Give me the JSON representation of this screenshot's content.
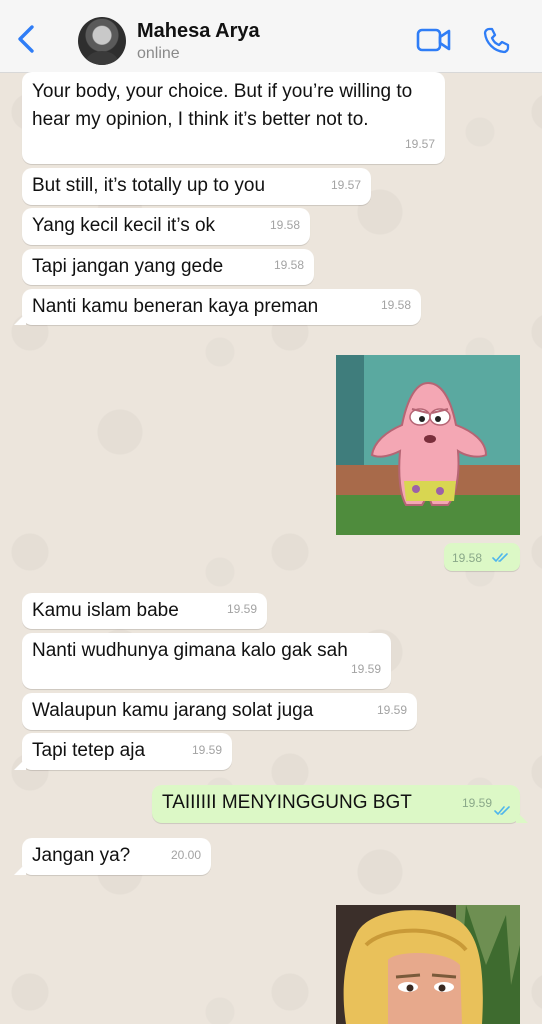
{
  "header": {
    "contact_name": "Mahesa Arya",
    "status": "online"
  },
  "colors": {
    "accent": "#2f7df6",
    "incoming_bubble": "#ffffff",
    "outgoing_bubble": "#dcf8c6",
    "read_ticks": "#4fb6ec"
  },
  "messages": [
    {
      "direction": "in",
      "text": "Your body, your choice. But if you’re willing to hear my opinion, I think it’s better not to.",
      "time": "19.57"
    },
    {
      "direction": "in",
      "text": "But still, it’s totally up to you",
      "time": "19.57"
    },
    {
      "direction": "in",
      "text": "Yang kecil kecil it’s ok",
      "time": "19.58"
    },
    {
      "direction": "in",
      "text": "Tapi jangan yang gede",
      "time": "19.58"
    },
    {
      "direction": "in",
      "text": "Nanti kamu beneran kaya preman",
      "time": "19.58"
    },
    {
      "direction": "out",
      "type": "sticker",
      "sticker": "patrick-star-sticker",
      "time": "19.58"
    },
    {
      "direction": "in",
      "text": "Kamu islam babe",
      "time": "19.59"
    },
    {
      "direction": "in",
      "text": "Nanti wudhunya gimana kalo gak sah",
      "time": "19.59"
    },
    {
      "direction": "in",
      "text": "Walaupun kamu jarang solat juga",
      "time": "19.59"
    },
    {
      "direction": "in",
      "text": "Tapi tetep aja",
      "time": "19.59"
    },
    {
      "direction": "out",
      "text": "TAIIIIII MENYINGGUNG BGT",
      "time": "19.59"
    },
    {
      "direction": "in",
      "text": "Jangan ya?",
      "time": "20.00"
    },
    {
      "direction": "out",
      "type": "sticker",
      "sticker": "blonde-girl-sticker"
    }
  ]
}
